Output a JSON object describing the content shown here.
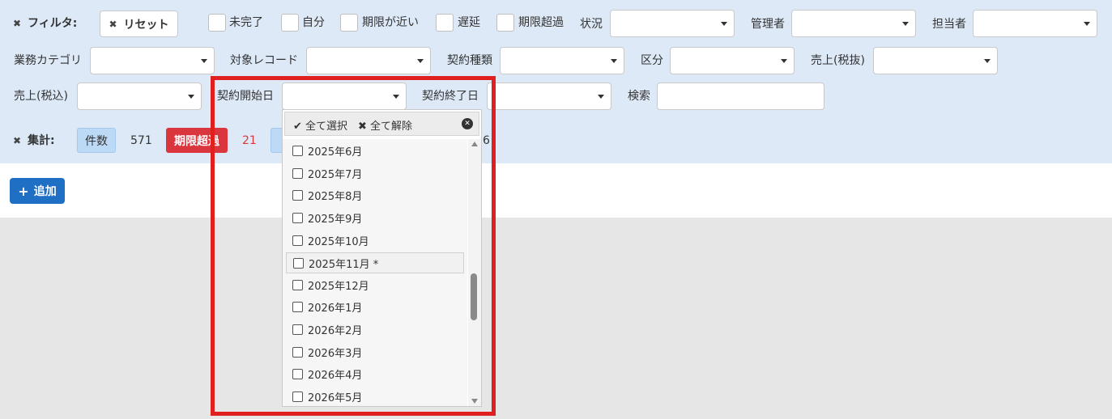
{
  "filter": {
    "title": "フィルタ:",
    "reset_label": "リセット",
    "checkboxes": [
      "未完了",
      "自分",
      "期限が近い",
      "遅延",
      "期限超過"
    ],
    "status_label": "状況",
    "manager_label": "管理者",
    "assignee_label": "担当者",
    "category_label": "業務カテゴリ",
    "target_label": "対象レコード",
    "contract_type_label": "契約種類",
    "division_label": "区分",
    "sales_ex_label": "売上(税抜)",
    "sales_in_label": "売上(税込)",
    "contract_start_label": "契約開始日",
    "contract_end_label": "契約終了日",
    "search_label": "検索"
  },
  "summary": {
    "title": "集計:",
    "count_label": "件数",
    "count_value": "571",
    "overdue_label": "期限超過",
    "overdue_value": "21",
    "partial_value": "6"
  },
  "toolbar": {
    "add_label": "追加"
  },
  "dropdown": {
    "select_all": "全て選択",
    "clear_all": "全て解除",
    "items": [
      "2025年6月",
      "2025年7月",
      "2025年8月",
      "2025年9月",
      "2025年10月",
      "2025年11月 *",
      "2025年12月",
      "2026年1月",
      "2026年2月",
      "2026年3月",
      "2026年4月",
      "2026年5月"
    ]
  },
  "colors": {
    "panel_bg": "#dde9f7",
    "accent_blue": "#1f6fc5",
    "danger_red": "#d9363e",
    "highlight_red": "#e0201e"
  }
}
